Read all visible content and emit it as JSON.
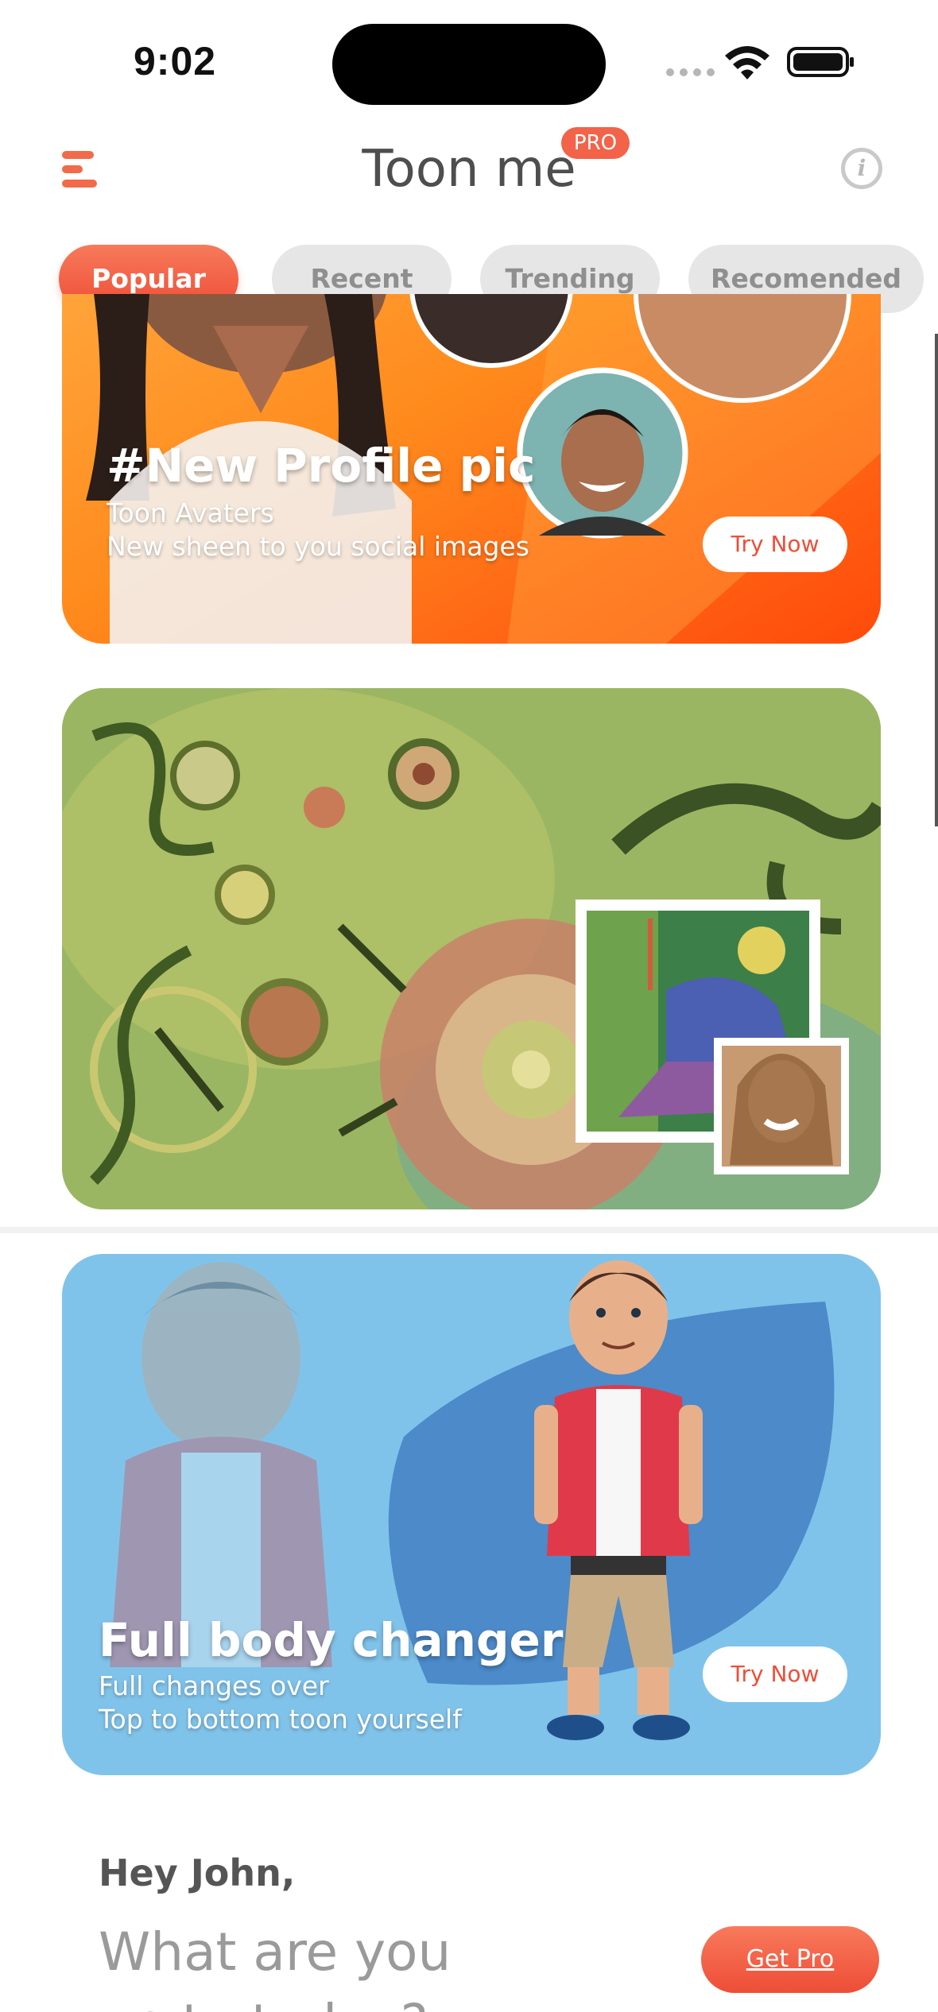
{
  "status_bar": {
    "time": "9:02"
  },
  "header": {
    "title": "Toon me",
    "pro_badge": "PRO",
    "info_symbol": "i"
  },
  "tabs": [
    {
      "label": "Popular",
      "active": true
    },
    {
      "label": "Recent",
      "active": false
    },
    {
      "label": "Trending",
      "active": false
    },
    {
      "label": "Recomended",
      "active": false
    }
  ],
  "cards": [
    {
      "title": "#New Profile pic",
      "subtitle1": "Toon Avaters",
      "subtitle2": "New sheen to you social images",
      "button": "Try Now",
      "bg_color": "#ff7a1a"
    },
    {
      "title": "",
      "bg_color": "#8fae57"
    },
    {
      "title": "Full body changer",
      "subtitle1": "Full changes over",
      "subtitle2": "Top to bottom toon yourself",
      "button": "Try Now",
      "bg_color": "#80c3ea"
    }
  ],
  "greeting": {
    "hello": "Hey John,",
    "question_line1": "What are you",
    "question_line2": "up to today?",
    "get_pro": "Get Pro"
  },
  "colors": {
    "accent": "#ee4d36",
    "tab_inactive": "#e6e6e6",
    "title_text": "#4e4e4e"
  }
}
